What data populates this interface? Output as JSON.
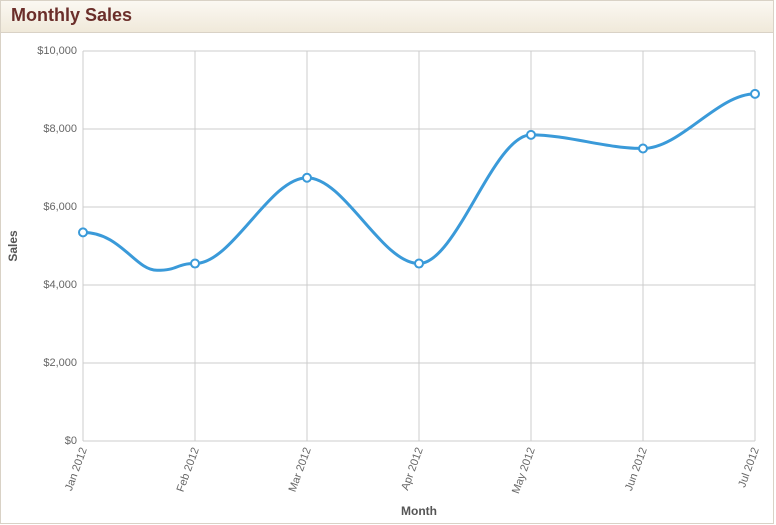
{
  "header": {
    "title": "Monthly Sales"
  },
  "chart_data": {
    "type": "line",
    "title": "",
    "xlabel": "Month",
    "ylabel": "Sales",
    "categories": [
      "Jan 2012",
      "Feb 2012",
      "Mar 2012",
      "Apr 2012",
      "May 2012",
      "Jun 2012",
      "Jul 2012"
    ],
    "values": [
      5350,
      4550,
      6750,
      4550,
      7850,
      7500,
      8900
    ],
    "ylim": [
      0,
      10000
    ],
    "yticks": [
      0,
      2000,
      4000,
      6000,
      8000,
      10000
    ],
    "ytick_labels": [
      "$0",
      "$2,000",
      "$4,000",
      "$6,000",
      "$8,000",
      "$10,000"
    ]
  }
}
